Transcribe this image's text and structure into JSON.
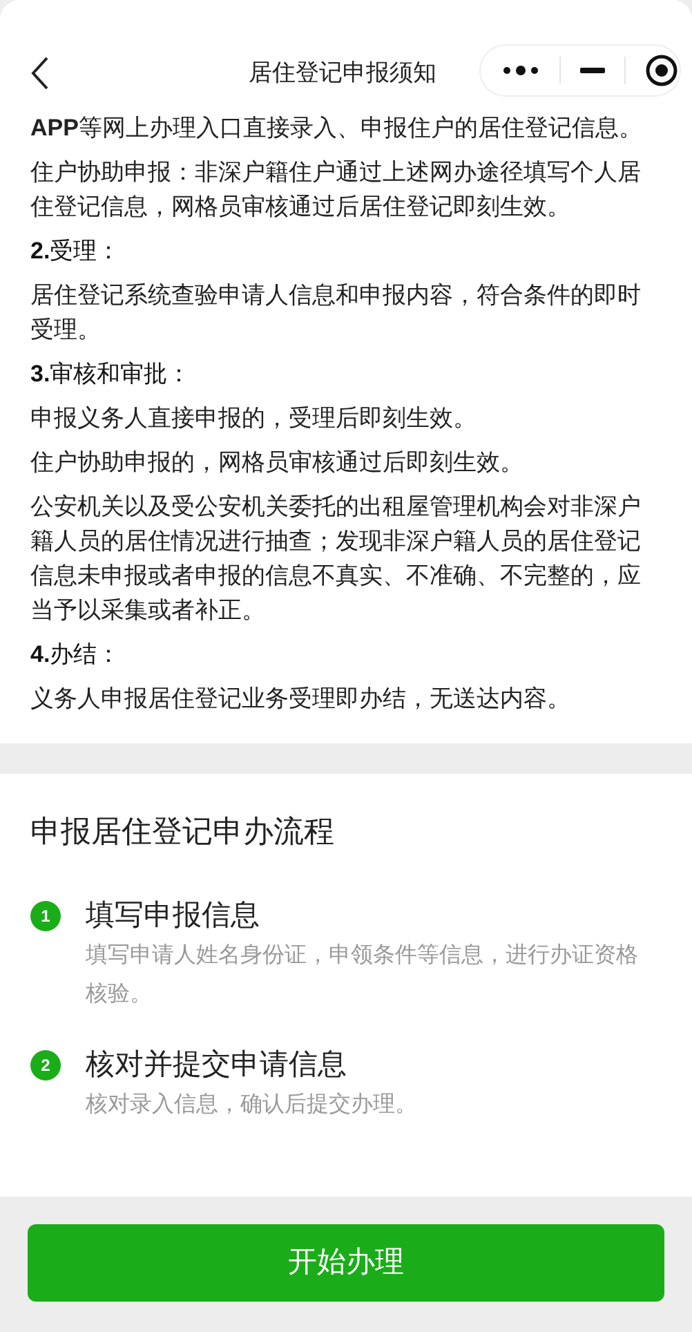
{
  "nav": {
    "title": "居住登记申报须知"
  },
  "paragraphs": [
    {
      "kind": "body",
      "text": "**APP**等网上办理入口直接录入、申报住户的居住登记信息。"
    },
    {
      "kind": "body",
      "text": "住户协助申报：非深户籍住户通过上述网办途径填写个人居住登记信息，网格员审核通过后居住登记即刻生效。"
    },
    {
      "kind": "heading",
      "text": "**2.**受理："
    },
    {
      "kind": "body",
      "text": "居住登记系统查验申请人信息和申报内容，符合条件的即时受理。"
    },
    {
      "kind": "heading",
      "text": "**3.**审核和审批："
    },
    {
      "kind": "body",
      "text": "申报义务人直接申报的，受理后即刻生效。"
    },
    {
      "kind": "body",
      "text": "住户协助申报的，网格员审核通过后即刻生效。"
    },
    {
      "kind": "body",
      "text": "公安机关以及受公安机关委托的出租屋管理机构会对非深户籍人员的居住情况进行抽查；发现非深户籍人员的居住登记信息未申报或者申报的信息不真实、不准确、不完整的，应当予以采集或者补正。"
    },
    {
      "kind": "heading",
      "text": "**4.**办结："
    },
    {
      "kind": "body",
      "text": "义务人申报居住登记业务受理即办结，无送达内容。"
    }
  ],
  "process": {
    "title": "申报居住登记申办流程",
    "steps": [
      {
        "number": "1",
        "title": "填写申报信息",
        "description": "填写申请人姓名身份证，申领条件等信息，进行办证资格核验。"
      },
      {
        "number": "2",
        "title": "核对并提交申请信息",
        "description": "核对录入信息，确认后提交办理。"
      }
    ]
  },
  "action_button": "开始办理"
}
